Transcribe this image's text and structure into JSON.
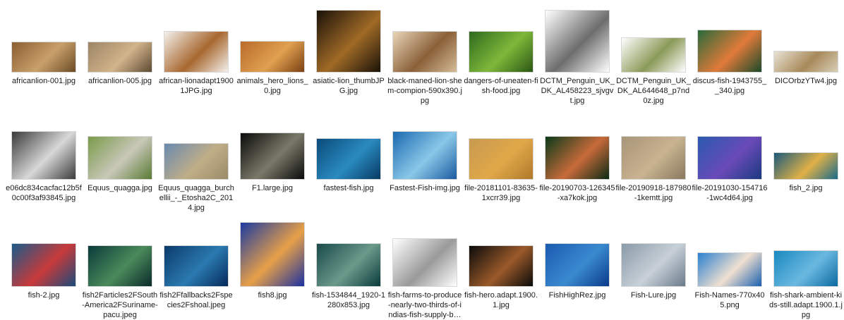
{
  "items": [
    {
      "name": "africanlion-001.jpg",
      "label": "africanlion-001.jpg",
      "colors": [
        "#8a5e32",
        "#c9a06a",
        "#6a4a26"
      ],
      "w": 90,
      "h": 42
    },
    {
      "name": "africanlion-005.jpg",
      "label": "africanlion-005.jpg",
      "colors": [
        "#9b8466",
        "#d2b48a",
        "#5d4a34"
      ],
      "w": 90,
      "h": 42
    },
    {
      "name": "african-lionadapt19001JPG.jpg",
      "label": "african-lionadapt19001JPG.jpg",
      "colors": [
        "#f4f1ec",
        "#a86830",
        "#f4f1ec"
      ],
      "w": 90,
      "h": 57
    },
    {
      "name": "animals_hero_lions_0.jpg",
      "label": "animals_hero_lions_0.jpg",
      "colors": [
        "#b86b2a",
        "#e0a050",
        "#7a4012"
      ],
      "w": 90,
      "h": 43
    },
    {
      "name": "asiatic-lion_thumbJPG.jpg",
      "label": "asiatic-lion_thumbJPG.jpg",
      "colors": [
        "#1a1208",
        "#a06a26",
        "#1a1208"
      ],
      "w": 90,
      "h": 87
    },
    {
      "name": "black-maned-lion-shem-compion-590x390.jpg",
      "label": "black-maned-lion-shem-compion-590x390.jpg",
      "colors": [
        "#e8d5b8",
        "#8a6038",
        "#d4bc98"
      ],
      "w": 90,
      "h": 57
    },
    {
      "name": "dangers-of-uneaten-fish-food.jpg",
      "label": "dangers-of-uneaten-fish-food.jpg",
      "colors": [
        "#2e6a1e",
        "#7fb83a",
        "#2a5614"
      ],
      "w": 90,
      "h": 57
    },
    {
      "name": "DCTM_Penguin_UK_DK_AL458223_sjvgvt.jpg",
      "label": "DCTM_Penguin_UK_DK_AL458223_sjvgvt.jpg",
      "colors": [
        "#ffffff",
        "#6d6d6d",
        "#ffffff"
      ],
      "w": 90,
      "h": 87
    },
    {
      "name": "DCTM_Penguin_UK_DK_AL644648_p7nd0z.jpg",
      "label": "DCTM_Penguin_UK_DK_AL644648_p7nd0z.jpg",
      "colors": [
        "#ffffff",
        "#8a9a58",
        "#ffffff"
      ],
      "w": 90,
      "h": 48
    },
    {
      "name": "discus-fish-1943755__340.jpg",
      "label": "discus-fish-1943755__340.jpg",
      "colors": [
        "#2a6a3a",
        "#e07a3a",
        "#1a4a2a"
      ],
      "w": 90,
      "h": 59
    },
    {
      "name": "DICOrbzYTw4.jpg",
      "label": "DICOrbzYTw4.jpg",
      "colors": [
        "#e8e2d4",
        "#a88a5a",
        "#d8cfb8"
      ],
      "w": 90,
      "h": 29
    },
    {
      "name": "e06dc834cacfac12b5f0c00f3af93845.jpg",
      "label": "e06dc834cacfac12b5f0c00f3af93845.jpg",
      "colors": [
        "#3a3a3a",
        "#d8d8d8",
        "#3a3a3a"
      ],
      "w": 90,
      "h": 67
    },
    {
      "name": "Equus_quagga.jpg",
      "label": "Equus_quagga.jpg",
      "colors": [
        "#7a9a4a",
        "#c8c8b8",
        "#5a7a34"
      ],
      "w": 90,
      "h": 60
    },
    {
      "name": "Equus_quagga_burchellii_-_Etosha2C_2014.jpg",
      "label": "Equus_quagga_burchellii_-_Etosha2C_2014.jpg",
      "colors": [
        "#6a8ab0",
        "#bfae88",
        "#9a8a66"
      ],
      "w": 90,
      "h": 50
    },
    {
      "name": "F1.large.jpg",
      "label": "F1.large.jpg",
      "colors": [
        "#0a0a0a",
        "#7a7a6a",
        "#0a0a0a"
      ],
      "w": 90,
      "h": 65
    },
    {
      "name": "fastest-fish.jpg",
      "label": "fastest-fish.jpg",
      "colors": [
        "#0a4a7a",
        "#2a8ac0",
        "#063a62"
      ],
      "w": 90,
      "h": 57
    },
    {
      "name": "Fastest-Fish-img.jpg",
      "label": "Fastest-Fish-img.jpg",
      "colors": [
        "#1a6ab0",
        "#8ac8e8",
        "#1a5aa0"
      ],
      "w": 90,
      "h": 67
    },
    {
      "name": "file-20181101-83635-1xcrr39.jpg",
      "label": "file-20181101-83635-1xcrr39.jpg",
      "colors": [
        "#c89a50",
        "#e0a848",
        "#b0782a"
      ],
      "w": 90,
      "h": 57
    },
    {
      "name": "file-20190703-126345-xa7kok.jpg",
      "label": "file-20190703-126345-xa7kok.jpg",
      "colors": [
        "#0a3a1a",
        "#c86a3a",
        "#0a2a14"
      ],
      "w": 90,
      "h": 60
    },
    {
      "name": "file-20190918-187980-1kemtt.jpg",
      "label": "file-20190918-187980-1kemtt.jpg",
      "colors": [
        "#a89478",
        "#c8b490",
        "#8a7860"
      ],
      "w": 90,
      "h": 60
    },
    {
      "name": "file-20191030-154716-1wc4d64.jpg",
      "label": "file-20191030-154716-1wc4d64.jpg",
      "colors": [
        "#2a5ab0",
        "#6a4ab8",
        "#1a3a80"
      ],
      "w": 90,
      "h": 60
    },
    {
      "name": "fish_2.jpg",
      "label": "fish_2.jpg",
      "colors": [
        "#1a5a7a",
        "#e0b048",
        "#1a6a8a"
      ],
      "w": 90,
      "h": 37
    },
    {
      "name": "fish-2.jpg",
      "label": "fish-2.jpg",
      "colors": [
        "#1a5a8a",
        "#c83a3a",
        "#1a4a7a"
      ],
      "w": 90,
      "h": 60
    },
    {
      "name": "fish2Farticles2FSouth-America2FSuriname-pacu.jpeg",
      "label": "fish2Farticles2FSouth-America2FSuriname-pacu.jpeg",
      "colors": [
        "#0a3a3a",
        "#4a8a5a",
        "#0a2a2a"
      ],
      "w": 90,
      "h": 57
    },
    {
      "name": "fish2Ffallbacks2Fspecies2Fshoal.jpeg",
      "label": "fish2Ffallbacks2Fspecies2Fshoal.jpeg",
      "colors": [
        "#0a3a6a",
        "#2a7ab0",
        "#062a5a"
      ],
      "w": 90,
      "h": 57
    },
    {
      "name": "fish8.jpg",
      "label": "fish8.jpg",
      "colors": [
        "#1a3aa0",
        "#e8a048",
        "#1a30a0"
      ],
      "w": 90,
      "h": 90
    },
    {
      "name": "fish-1534844_1920-1280x853.jpg",
      "label": "fish-1534844_1920-1280x853.jpg",
      "colors": [
        "#1a4a4a",
        "#6a9a8a",
        "#0a3a3a"
      ],
      "w": 90,
      "h": 60
    },
    {
      "name": "fish-farms-to-produce-nearly-two-thirds-of-indias-fish-supply-b…",
      "label": "fish-farms-to-produce-nearly-two-thirds-of-indias-fish-supply-b…",
      "colors": [
        "#ffffff",
        "#9a9a9a",
        "#ffffff"
      ],
      "w": 90,
      "h": 67
    },
    {
      "name": "fish-hero.adapt.1900.1.jpg",
      "label": "fish-hero.adapt.1900.1.jpg",
      "colors": [
        "#0a0a0a",
        "#9a5a2a",
        "#0a0a0a"
      ],
      "w": 90,
      "h": 57
    },
    {
      "name": "FishHighRez.jpg",
      "label": "FishHighRez.jpg",
      "colors": [
        "#1a5ab0",
        "#3a8ad0",
        "#0a3a8a"
      ],
      "w": 90,
      "h": 60
    },
    {
      "name": "Fish-Lure.jpg",
      "label": "Fish-Lure.jpg",
      "colors": [
        "#8a9aa8",
        "#c8d0d8",
        "#6a7a8a"
      ],
      "w": 90,
      "h": 60
    },
    {
      "name": "Fish-Names-770x405.png",
      "label": "Fish-Names-770x405.png",
      "colors": [
        "#2a80d0",
        "#f0e0d0",
        "#1a60b0"
      ],
      "w": 90,
      "h": 47
    },
    {
      "name": "fish-shark-ambient-kids-still.adapt.1900.1.jpg",
      "label": "fish-shark-ambient-kids-still.adapt.1900.1.jpg",
      "colors": [
        "#1a8ac0",
        "#6ab8e0",
        "#0a6aa0"
      ],
      "w": 90,
      "h": 50
    }
  ]
}
